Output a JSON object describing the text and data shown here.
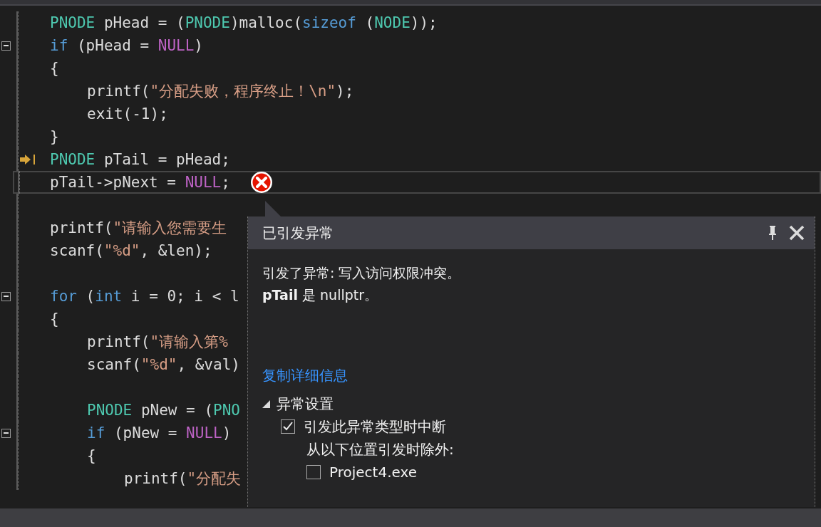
{
  "editor": {
    "lines": [
      {
        "kind": "code",
        "tokens": [
          {
            "t": "PNODE",
            "color": "#4ec9b0"
          },
          {
            "t": "pHead = ("
          },
          {
            "t": "PNODE",
            "color": "#4ec9b0"
          },
          {
            "t": ")malloc("
          },
          {
            "t": "sizeof",
            "color": "#569cd6"
          },
          {
            "t": "("
          },
          {
            "t": "NODE",
            "color": "#4ec9b0"
          },
          {
            "t": "));"
          }
        ],
        "fold": false,
        "current": false,
        "error": false
      },
      {
        "kind": "code",
        "tokens": [
          {
            "t": "if",
            "color": "#569cd6"
          },
          {
            "t": "(pHead = "
          },
          {
            "t": "NULL",
            "color": "#bd63c5"
          },
          {
            "t": ")"
          }
        ],
        "fold": true,
        "current": false,
        "error": false
      },
      {
        "kind": "code",
        "tokens": [
          {
            "t": "{"
          }
        ],
        "fold": false,
        "current": false,
        "error": false,
        "children": [
          {
            "kind": "code",
            "tokens": [
              {
                "t": "printf("
              },
              {
                "t": "\"分配失败，程序终止！\\n\"",
                "color": "#d69d85"
              },
              {
                "t": ");"
              }
            ],
            "fold": false,
            "current": false,
            "error": false
          },
          {
            "kind": "code",
            "tokens": [
              {
                "t": "exit(-1);"
              }
            ],
            "fold": false,
            "current": false,
            "error": false
          }
        ]
      },
      {
        "kind": "code",
        "tokens": [
          {
            "t": "}"
          }
        ],
        "fold": false,
        "current": false,
        "error": false
      },
      {
        "kind": "code",
        "tokens": [
          {
            "t": "PNODE",
            "color": "#4ec9b0"
          },
          {
            "t": "pTail = pHead;"
          }
        ],
        "fold": false,
        "current": true,
        "error": false
      },
      {
        "kind": "code",
        "tokens": [
          {
            "t": "pTail->pNext = "
          },
          {
            "t": "NULL",
            "color": "#bd63c5"
          },
          {
            "t": ";"
          }
        ],
        "fold": false,
        "current": false,
        "error": true
      },
      {
        "kind": "blank"
      },
      {
        "kind": "code",
        "tokens": [
          {
            "t": "printf("
          },
          {
            "t": "\"请输入您需要生",
            "color": "#d69d85"
          }
        ],
        "fold": false,
        "current": false,
        "error": false
      },
      {
        "kind": "code",
        "tokens": [
          {
            "t": "scanf("
          },
          {
            "t": "\"%d\"",
            "color": "#d69d85"
          },
          {
            "t": ", &len);"
          }
        ],
        "fold": false,
        "current": false,
        "error": false
      },
      {
        "kind": "blank"
      },
      {
        "kind": "code",
        "tokens": [
          {
            "t": "for",
            "color": "#569cd6"
          },
          {
            "t": "("
          },
          {
            "t": "int",
            "color": "#569cd6"
          },
          {
            "t": "i = 0; i < l"
          }
        ],
        "fold": true,
        "current": false,
        "error": false
      },
      {
        "kind": "code",
        "tokens": [
          {
            "t": "{"
          }
        ],
        "fold": false,
        "current": false,
        "error": false,
        "children": [
          {
            "kind": "code",
            "tokens": [
              {
                "t": "printf("
              },
              {
                "t": "\"请输入第%",
                "color": "#d69d85"
              }
            ],
            "fold": false,
            "current": false,
            "error": false
          },
          {
            "kind": "code",
            "tokens": [
              {
                "t": "scanf("
              },
              {
                "t": "\"%d\"",
                "color": "#d69d85"
              },
              {
                "t": ", &val)"
              }
            ],
            "fold": false,
            "current": false,
            "error": false
          },
          {
            "kind": "blank"
          },
          {
            "kind": "code",
            "tokens": [
              {
                "t": "PNODE",
                "color": "#4ec9b0"
              },
              {
                "t": "pNew = ("
              },
              {
                "t": "PNO",
                "color": "#4ec9b0"
              }
            ],
            "fold": false,
            "current": false,
            "error": false
          },
          {
            "kind": "code",
            "tokens": [
              {
                "t": "if",
                "color": "#569cd6"
              },
              {
                "t": "(pNew = "
              },
              {
                "t": "NULL",
                "color": "#bd63c5"
              },
              {
                "t": ")"
              }
            ],
            "fold": true,
            "current": false,
            "error": false
          },
          {
            "kind": "code",
            "tokens": [
              {
                "t": "{"
              }
            ],
            "fold": false,
            "current": false,
            "error": false,
            "children": [
              {
                "kind": "code",
                "tokens": [
                  {
                    "t": "printf("
                  },
                  {
                    "t": "\"分配失",
                    "color": "#d69d85"
                  }
                ],
                "fold": false,
                "current": false,
                "error": false
              }
            ]
          }
        ]
      }
    ]
  },
  "exception_popup": {
    "title": "已引发异常",
    "message": [
      "引发了异常: 写入访问权限冲突。",
      "**pTail** 是 nullptr。"
    ],
    "link": "复制详细信息",
    "settings": {
      "label": "异常设置",
      "expanded": true,
      "items": [
        {
          "kind": "checkbox",
          "label": "引发此异常类型时中断",
          "checked": true
        },
        {
          "kind": "text",
          "label": "从以下位置引发时除外:"
        },
        {
          "kind": "checkbox",
          "label": "Project4.exe",
          "checked": false
        }
      ]
    }
  }
}
